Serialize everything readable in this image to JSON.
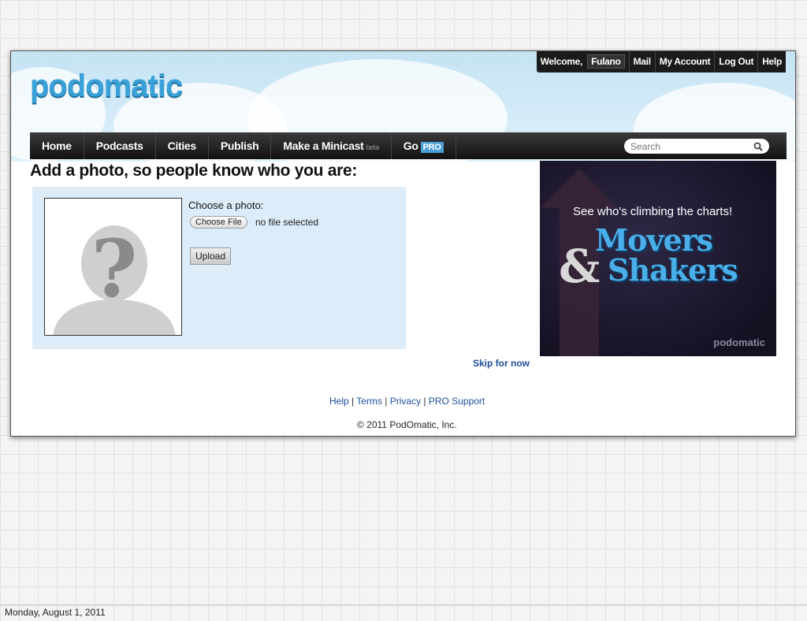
{
  "site": {
    "logo_text": "podomatic",
    "brand_color": "#3aa0d8"
  },
  "topbar": {
    "welcome_label": "Welcome,",
    "username": "Fulano",
    "items": [
      "Mail",
      "My Account",
      "Log Out",
      "Help"
    ]
  },
  "nav": {
    "home": "Home",
    "podcasts": "Podcasts",
    "cities": "Cities",
    "publish": "Publish",
    "minicast": "Make a Minicast",
    "minicast_badge": "beta",
    "go": "Go",
    "go_badge": "PRO"
  },
  "search": {
    "placeholder": "Search",
    "icon": "magnifier-icon"
  },
  "main": {
    "heading": "Add a photo, so people know who you are:",
    "choose_label": "Choose a photo:",
    "file_button": "Choose File",
    "file_status": "no file selected",
    "upload_button": "Upload",
    "avatar_icon": "unknown-person-icon",
    "avatar_glyph": "?"
  },
  "ad": {
    "tagline": "See who's climbing the charts!",
    "amp": "&",
    "movers": "Movers",
    "shakers": "Shakers",
    "brand": "podomatic"
  },
  "skip_link": "Skip for now",
  "footer": {
    "links": [
      "Help",
      "Terms",
      "Privacy",
      "PRO Support"
    ],
    "separator": " | ",
    "copyright": "© 2011 PodOmatic, Inc."
  },
  "slide": {
    "date": "Monday, August 1, 2011"
  }
}
